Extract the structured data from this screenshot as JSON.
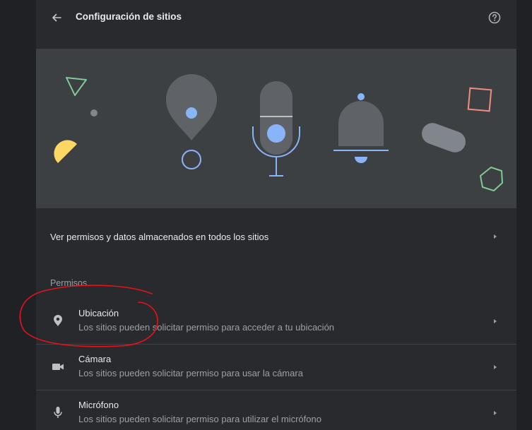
{
  "header": {
    "title": "Configuración de sitios",
    "back_icon": "arrow-back-icon",
    "help_icon": "help-icon"
  },
  "all_sites": {
    "label": "Ver permisos y datos almacenados en todos los sitios"
  },
  "permissions": {
    "section_title": "Permisos",
    "items": [
      {
        "title": "Ubicación",
        "description": "Los sitios pueden solicitar permiso para acceder a tu ubicación",
        "icon": "location-pin-icon"
      },
      {
        "title": "Cámara",
        "description": "Los sitios pueden solicitar permiso para usar la cámara",
        "icon": "camera-icon"
      },
      {
        "title": "Micrófono",
        "description": "Los sitios pueden solicitar permiso para utilizar el micrófono",
        "icon": "microphone-icon"
      }
    ]
  },
  "colors": {
    "page_background": "#202124",
    "panel_background": "#292a2d",
    "hero_background": "#3c4043",
    "accent_blue": "#8ab4f8",
    "text_primary": "#e8eaed",
    "text_secondary": "#9aa0a6",
    "annotation_red": "#e8121b"
  }
}
